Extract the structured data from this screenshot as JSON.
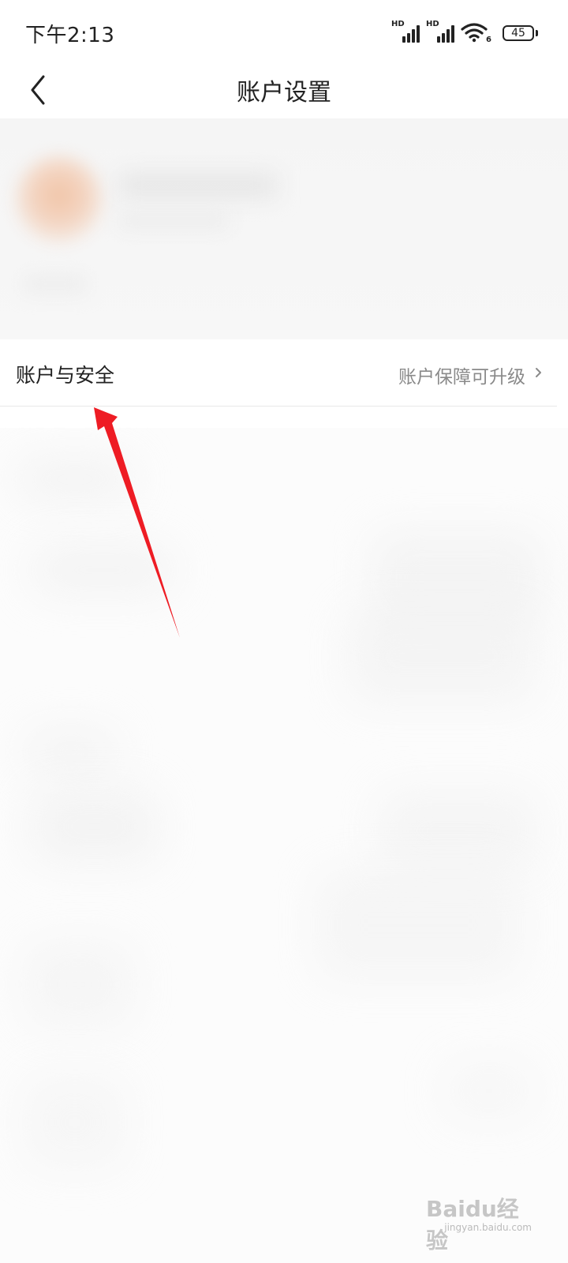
{
  "status_bar": {
    "time": "下午2:13",
    "network_1": "HD",
    "network_2": "HD",
    "wifi_label": "6",
    "battery": "45"
  },
  "nav": {
    "title": "账户设置",
    "back_icon": "chevron-left-icon"
  },
  "settings": {
    "items": [
      {
        "label": "账户与安全",
        "value": "账户保障可升级",
        "icon": "chevron-right-icon"
      }
    ]
  },
  "annotation": {
    "color": "#ee1c24"
  },
  "watermark": {
    "line1": "Baidu经验",
    "line2": "jingyan.baidu.com"
  }
}
